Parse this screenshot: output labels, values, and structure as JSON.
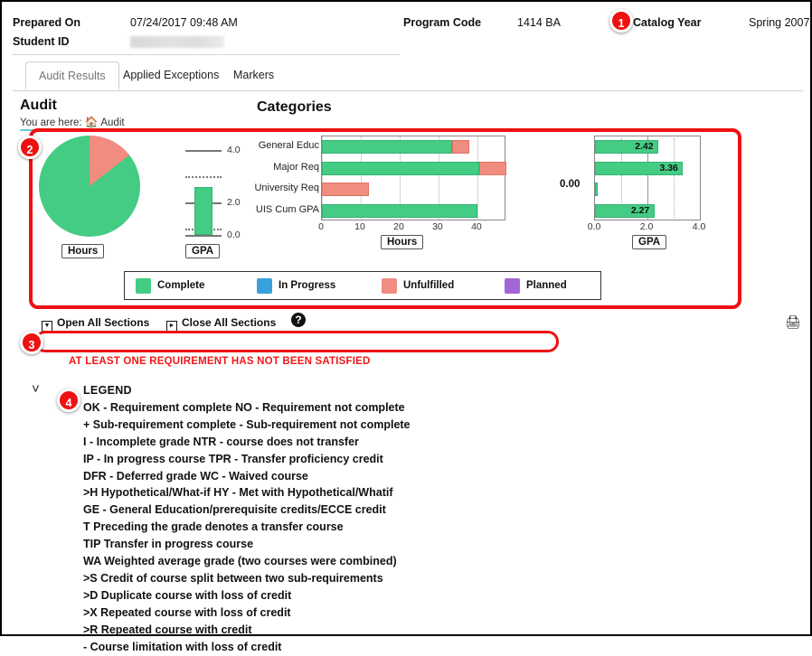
{
  "header": {
    "prepared_on_label": "Prepared On",
    "prepared_on_value": "07/24/2017 09:48 AM",
    "program_code_label": "Program Code",
    "program_code_value": "1414 BA",
    "catalog_year_label": "Catalog Year",
    "catalog_year_value": "Spring 2007",
    "student_id_label": "Student ID",
    "student_id_value": ""
  },
  "tabs": [
    {
      "label": "Audit Results",
      "active": true
    },
    {
      "label": "Applied Exceptions",
      "active": false
    },
    {
      "label": "Markers",
      "active": false
    }
  ],
  "audit": {
    "heading": "Audit",
    "breadcrumb_prefix": "You are here:",
    "breadcrumb_home_icon": "home-icon",
    "breadcrumb_current": "Audit"
  },
  "categories": {
    "heading": "Categories"
  },
  "chart_data": [
    {
      "type": "pie",
      "title": "Hours",
      "labels": [
        "Complete",
        "Unfulfilled"
      ],
      "values": [
        85.5,
        14.5
      ],
      "colors": [
        "#44cc84",
        "#f08c80"
      ]
    },
    {
      "type": "bar",
      "title": "GPA",
      "orientation": "vertical",
      "categories": [
        "GPA"
      ],
      "values": [
        2.27
      ],
      "ylim": [
        0.0,
        4.0
      ],
      "yticks": [
        "0.0",
        "2.0",
        "4.0"
      ],
      "color": "#44cc84"
    },
    {
      "type": "bar",
      "title": "Hours",
      "orientation": "horizontal",
      "stacked": true,
      "categories": [
        "General Educ",
        "Major Req",
        "University Req",
        "UIS Cum GPA"
      ],
      "series": [
        {
          "name": "Complete",
          "color": "#44cc84",
          "values": [
            33.5,
            40.5,
            0,
            40.0
          ]
        },
        {
          "name": "Unfulfilled",
          "color": "#f08c80",
          "values": [
            4.5,
            7.0,
            12.0,
            0
          ]
        }
      ],
      "xlim": [
        0,
        47
      ],
      "xticks": [
        "0",
        "10",
        "20",
        "30",
        "40"
      ],
      "xlabel": "Hours",
      "grid": true
    },
    {
      "type": "bar",
      "title": "GPA",
      "orientation": "horizontal",
      "categories": [
        "General Educ",
        "Major Req",
        "University Req",
        "UIS Cum GPA"
      ],
      "values": [
        2.42,
        3.36,
        0.0,
        2.27
      ],
      "value_labels": [
        "2.42",
        "3.36",
        "0.00",
        "2.27"
      ],
      "xlim": [
        0.0,
        4.0
      ],
      "xticks": [
        "0.0",
        "2.0",
        "4.0"
      ],
      "xlabel": "GPA",
      "color": "#44cc84"
    }
  ],
  "legend_swatches": [
    {
      "label": "Complete",
      "color": "#44cc84"
    },
    {
      "label": "In Progress",
      "color": "#3aa0dd"
    },
    {
      "label": "Unfulfilled",
      "color": "#f08c80"
    },
    {
      "label": "Planned",
      "color": "#a366d6"
    }
  ],
  "sections": {
    "open_all": "Open All Sections",
    "close_all": "Close All Sections",
    "help_icon": "question-mark-icon",
    "print_icon": "printer-icon"
  },
  "warning": {
    "text": "AT LEAST ONE REQUIREMENT HAS NOT BEEN SATISFIED",
    "color": "#f01818"
  },
  "legend_block": {
    "chevron_icon": "chevron-down-icon",
    "lines": [
      "LEGEND",
      "OK - Requirement complete NO - Requirement not complete",
      "+ Sub-requirement complete - Sub-requirement not complete",
      "I - Incomplete grade NTR - course does not transfer",
      "IP - In progress course TPR - Transfer proficiency credit",
      "DFR - Deferred grade WC - Waived course",
      ">H Hypothetical/What-if HY - Met with Hypothetical/Whatif",
      "GE - General Education/prerequisite credits/ECCE credit",
      "T Preceding the grade denotes a transfer course",
      "TIP Transfer in progress course",
      "WA Weighted average grade (two courses were combined)",
      ">S Credit of course split between two sub-requirements",
      ">D Duplicate course with loss of credit",
      ">X Repeated course with loss of credit",
      ">R Repeated course with credit",
      "-   Course limitation with loss of credit"
    ]
  },
  "annotations": {
    "badges": [
      "1",
      "2",
      "3",
      "4"
    ],
    "color": "#ee1111"
  }
}
